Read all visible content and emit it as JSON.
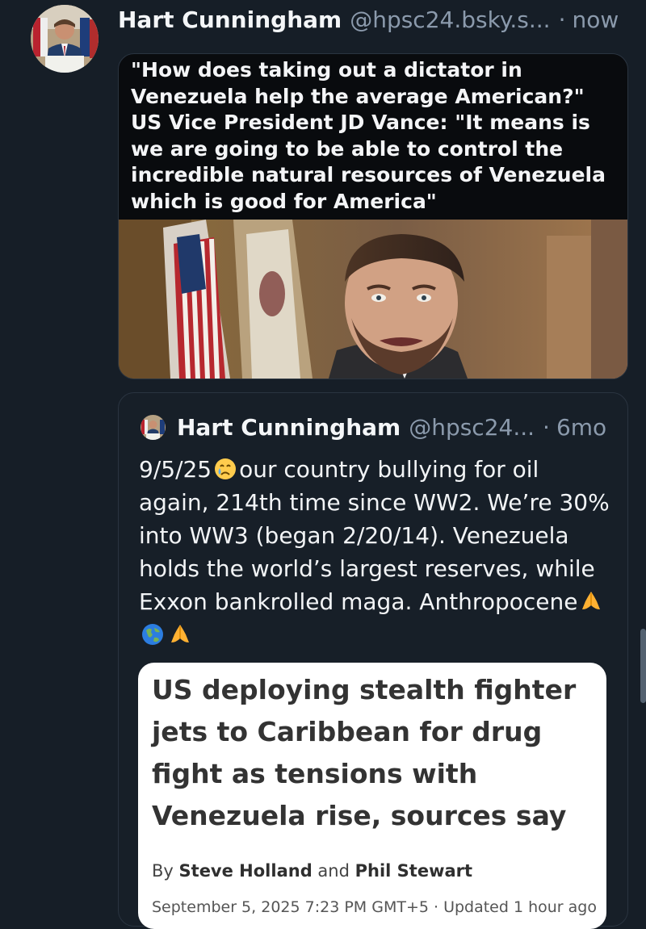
{
  "post": {
    "author_name": "Hart Cunningham",
    "handle": "@hpsc24.bsky.s...",
    "separator": "·",
    "time": "now",
    "avatar_icon": "profile-photo",
    "media": {
      "caption": "\"How does taking out a dictator in Venezuela help the average American?\" US Vice President JD Vance: \"It means is we are going to be able to control the incredible natural resources of Venezuela which is good for America\"",
      "image": "video-still-with-flags-and-speaker"
    }
  },
  "quoted_post": {
    "author_name": "Hart Cunningham",
    "handle": "@hpsc24...",
    "separator": "·",
    "time": "6mo",
    "avatar_icon": "small-profile-photo",
    "text_segments": {
      "part1": "9/5/25",
      "emoji1": "crying-face-emoji",
      "part2": "our country bullying for oil again, 214th time since WW2. We’re 30% into WW3 (began 2/20/14). Venezuela holds the world’s largest reserves, while Exxon bankrolled maga. Anthropocene",
      "emoji2": "folded-hands-emoji",
      "emoji3": "globe-emoji",
      "emoji4": "folded-hands-emoji"
    },
    "article": {
      "headline": "US deploying stealth fighter jets to Caribbean for drug fight as tensions with Venezuela rise, sources say",
      "byline_prefix": "By",
      "author1": "Steve Holland",
      "byline_and": "and",
      "author2": "Phil Stewart",
      "dateline": "September 5, 2025 7:23 PM GMT+5 · Updated 1 hour ago"
    }
  },
  "colors": {
    "background": "#161e27",
    "muted_text": "#8b9aac",
    "card_border": "#2a3440",
    "article_card": "#ffffff"
  }
}
